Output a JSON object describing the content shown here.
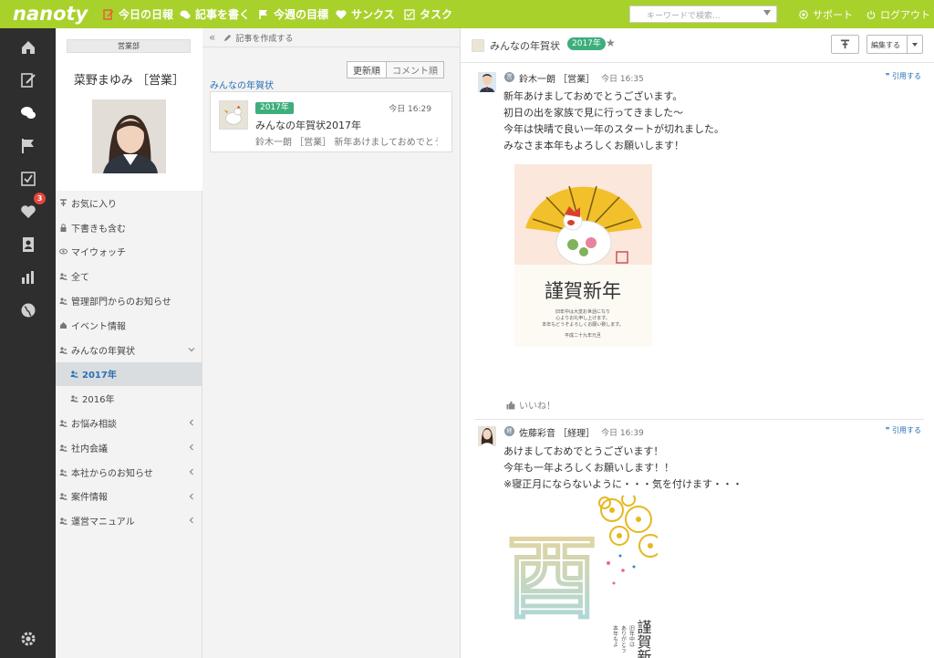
{
  "app": {
    "logo": "nanoty"
  },
  "topnav": {
    "items": [
      {
        "label": "今日の日報"
      },
      {
        "label": "記事を書く"
      },
      {
        "label": "今週の目標"
      },
      {
        "label": "サンクス"
      },
      {
        "label": "タスク"
      }
    ],
    "search_placeholder": "キーワードで検索...",
    "support": "サポート",
    "logout": "ログアウト"
  },
  "rail": {
    "badge": "3"
  },
  "profile": {
    "department": "営業部",
    "name": "菜野まゆみ ［営業］"
  },
  "sidebar": {
    "items": [
      {
        "label": "お気に入り"
      },
      {
        "label": "下書きも含む"
      },
      {
        "label": "マイウォッチ"
      },
      {
        "label": "全て"
      },
      {
        "label": "管理部門からのお知らせ"
      },
      {
        "label": "イベント情報"
      },
      {
        "label": "みんなの年賀状"
      },
      {
        "label": "2017年"
      },
      {
        "label": "2016年"
      },
      {
        "label": "お悩み相談"
      },
      {
        "label": "社内会議"
      },
      {
        "label": "本社からのお知らせ"
      },
      {
        "label": "案件情報"
      },
      {
        "label": "運営マニュアル"
      }
    ]
  },
  "middle": {
    "collapse": "«",
    "create": "記事を作成する",
    "sort": [
      "更新順",
      "コメント順"
    ],
    "group_label": "みんなの年賀状",
    "card": {
      "tag": "2017年",
      "time": "今日 16:29",
      "title": "みんなの年賀状2017年",
      "excerpt": "鈴木一朗 ［営業］ 新年あけましておめでとう"
    }
  },
  "detail": {
    "title": "みんなの年賀状",
    "tag": "2017年",
    "star": "★",
    "edit": "編集する",
    "posts": [
      {
        "badge": "営",
        "author": "鈴木一朗 ［営業］",
        "time": "今日 16:35",
        "quote": "引用する",
        "lines": [
          "新年あけましておめでとうございます。",
          "初日の出を家族で見に行ってきました〜",
          "今年は快晴で良い一年のスタートが切れました。",
          "みなさま本年もよろしくお願いします！"
        ],
        "card_text": {
          "greeting": "謹賀新年",
          "body1": "旧年中は大変お世話になり",
          "body2": "心よりお礼申し上げます。",
          "body3": "本年もどうぞよろしくお願い致します。",
          "date": "平成二十九年元旦"
        },
        "like": "いいね！"
      },
      {
        "badge": "経",
        "author": "佐藤彩音 ［経理］",
        "time": "今日 16:39",
        "quote": "引用する",
        "lines": [
          "あけましておめでとうございます！",
          "今年も一年よろしくお願いします！！",
          "※寝正月にならないように・・・気を付けます・・・"
        ],
        "card_text": {
          "kanji": "酉",
          "greeting": "謹賀新",
          "col1": "旧年中は",
          "col2": "ありがとう",
          "col3": "本年もよ"
        }
      }
    ]
  }
}
